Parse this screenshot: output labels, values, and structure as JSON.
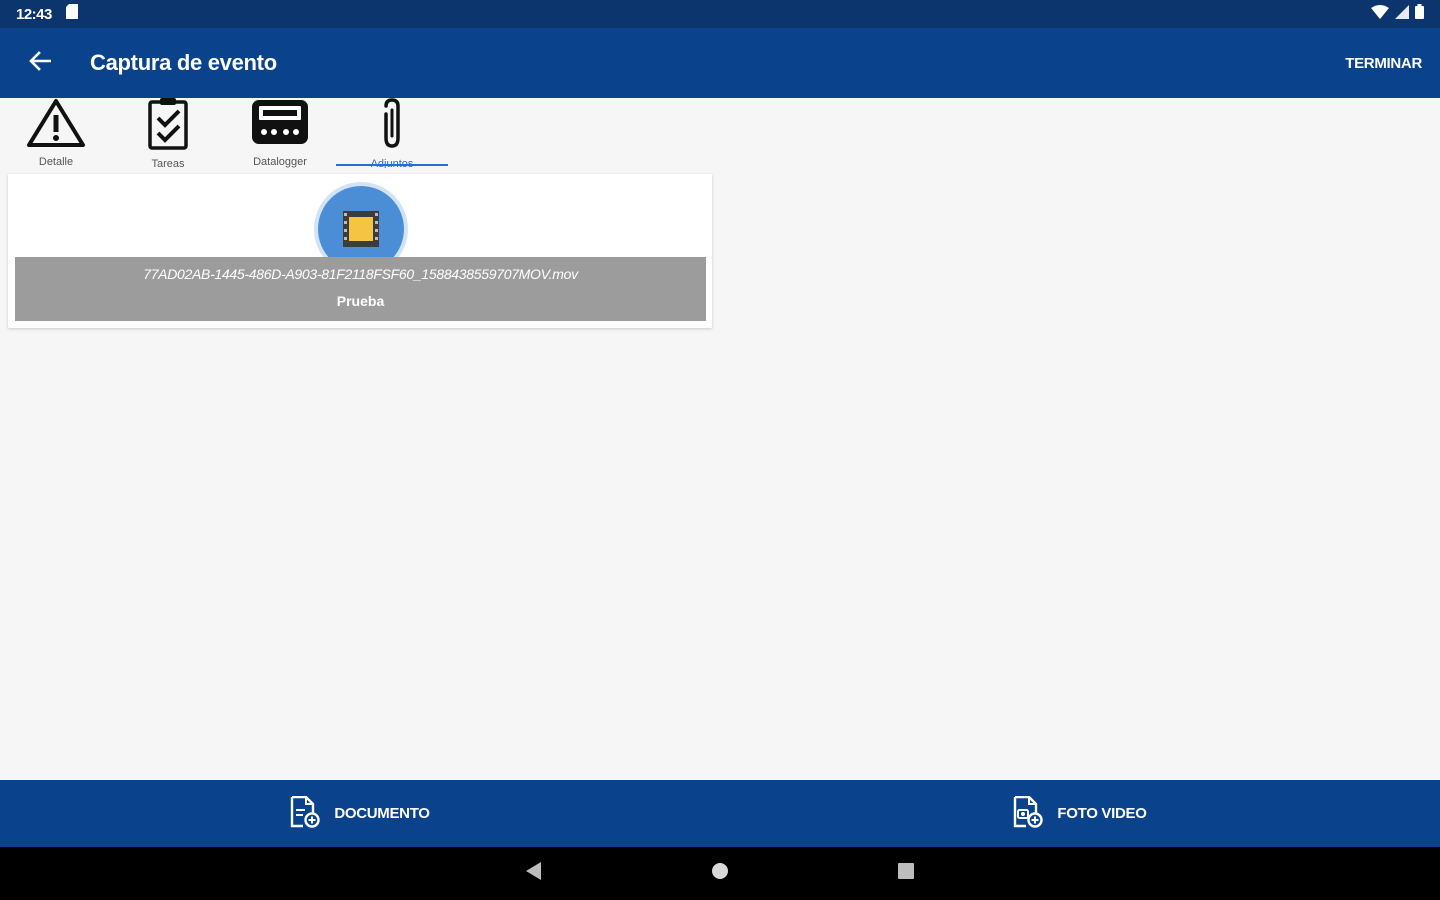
{
  "status_bar": {
    "time": "12:43"
  },
  "app_bar": {
    "title": "Captura de evento",
    "finish_label": "TERMINAR"
  },
  "tabs": [
    {
      "label": "Detalle",
      "icon": "warning-icon",
      "active": false
    },
    {
      "label": "Tareas",
      "icon": "checklist-icon",
      "active": false
    },
    {
      "label": "Datalogger",
      "icon": "datalogger-icon",
      "active": false
    },
    {
      "label": "Adjuntos",
      "icon": "paperclip-icon",
      "active": true
    }
  ],
  "attachment": {
    "file_name": "77AD02AB-1445-486D-A903-81F2118FSF60_1588438559707MOV.mov",
    "description": "Prueba",
    "icon": "video-file-icon"
  },
  "actions": {
    "document_label": "DOCUMENTO",
    "photo_video_label": "FOTO VIDEO"
  },
  "colors": {
    "primary": "#0a428c",
    "status_bar": "#0c356e",
    "accent": "#1f6fd8",
    "thumb": "#4c8ed6",
    "thumb_inner": "#f6c443"
  }
}
